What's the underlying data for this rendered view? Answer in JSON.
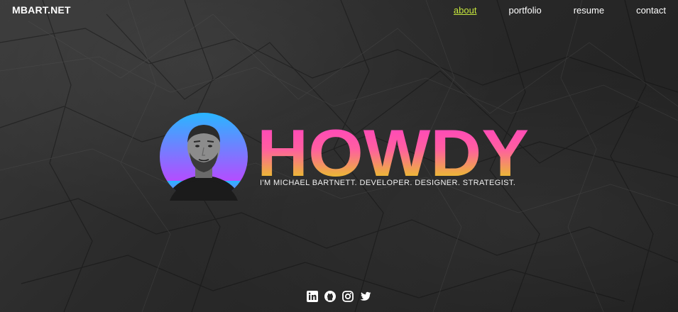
{
  "site": {
    "logo": "MBART.NET"
  },
  "nav": {
    "items": [
      {
        "label": "about",
        "active": true
      },
      {
        "label": "portfolio",
        "active": false
      },
      {
        "label": "resume",
        "active": false
      },
      {
        "label": "contact",
        "active": false
      }
    ]
  },
  "hero": {
    "headline": "HOWDY",
    "tagline": "I'M MICHAEL BARTNETT. DEVELOPER. DESIGNER. STRATEGIST.",
    "avatar_icon": "profile-photo"
  },
  "socials": [
    {
      "icon": "linkedin-icon"
    },
    {
      "icon": "github-icon"
    },
    {
      "icon": "instagram-icon"
    },
    {
      "icon": "twitter-icon"
    }
  ],
  "colors": {
    "accent": "#c6e73d",
    "gradient_top": "#ff3cc7",
    "gradient_bottom": "#e2e400",
    "avatar_top": "#29b6ff",
    "avatar_bottom": "#b44dff",
    "text": "#ffffff"
  }
}
